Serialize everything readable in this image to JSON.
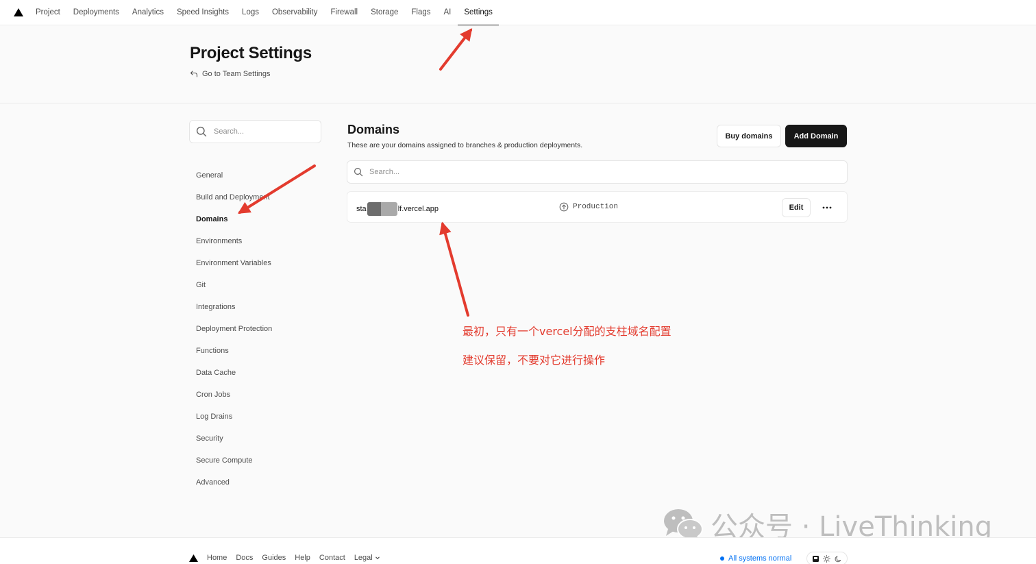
{
  "topnav": {
    "tabs": [
      "Project",
      "Deployments",
      "Analytics",
      "Speed Insights",
      "Logs",
      "Observability",
      "Firewall",
      "Storage",
      "Flags",
      "AI",
      "Settings"
    ],
    "active_tab": "Settings"
  },
  "header": {
    "title": "Project Settings",
    "team_link": "Go to Team Settings"
  },
  "sidebar": {
    "search_placeholder": "Search...",
    "items": [
      "General",
      "Build and Deployment",
      "Domains",
      "Environments",
      "Environment Variables",
      "Git",
      "Integrations",
      "Deployment Protection",
      "Functions",
      "Data Cache",
      "Cron Jobs",
      "Log Drains",
      "Security",
      "Secure Compute",
      "Advanced"
    ],
    "active_item": "Domains"
  },
  "main": {
    "title": "Domains",
    "subtitle": "These are your domains assigned to branches & production deployments.",
    "buy_label": "Buy domains",
    "add_label": "Add Domain",
    "search_placeholder": "Search...",
    "domains": [
      {
        "prefix": "sta",
        "suffix": "lf.vercel.app",
        "environment": "Production",
        "edit_label": "Edit",
        "more_label": "···"
      }
    ]
  },
  "annotations": {
    "note1": "最初，只有一个vercel分配的支柱域名配置",
    "note2": "建议保留，不要对它进行操作",
    "color": "#e33b2e"
  },
  "watermark": {
    "text": "公众号 · LiveThinking"
  },
  "footer": {
    "links": [
      "Home",
      "Docs",
      "Guides",
      "Help",
      "Contact",
      "Legal"
    ],
    "status": "All systems normal"
  },
  "colors": {
    "accent": "#171717",
    "status_blue": "#0070f3",
    "annotation_red": "#e33b2e"
  }
}
